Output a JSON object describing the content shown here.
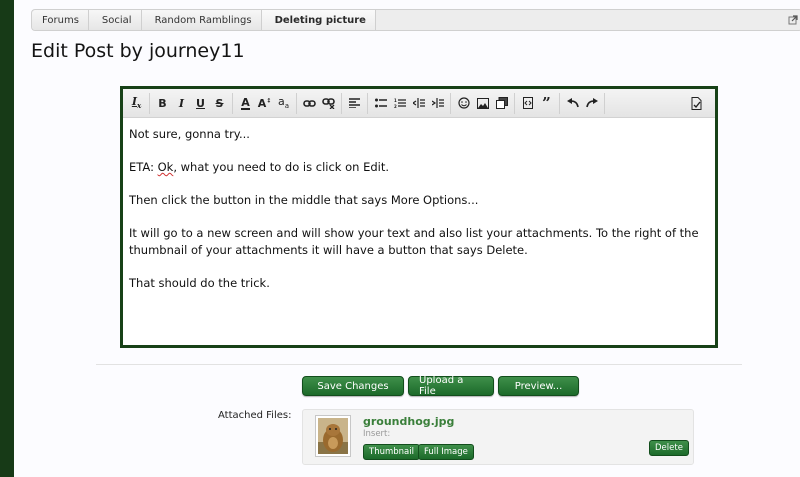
{
  "breadcrumb": {
    "items": [
      "Forums",
      "Social",
      "Random Ramblings",
      "Deleting picture"
    ]
  },
  "page_title": "Edit Post by journey11",
  "editor": {
    "paragraphs": [
      "Not sure, gonna try...",
      "Then click the button in the middle that says More Options...",
      "It will go to a new screen and will show your text and also list your attachments.  To the right of the thumbnail of your attachments it will have a button that says Delete.",
      "That should do the trick."
    ],
    "eta_prefix": "ETA:  ",
    "eta_ok": "Ok",
    "eta_rest": ", what you need to do is click on Edit."
  },
  "toolbar_icons": [
    "remove-format-icon",
    "bold-icon",
    "italic-icon",
    "underline-icon",
    "strikethrough-icon",
    "text-color-icon",
    "font-size-icon",
    "font-family-icon",
    "link-icon",
    "unlink-icon",
    "align-icon",
    "bullet-list-icon",
    "numbered-list-icon",
    "outdent-icon",
    "indent-icon",
    "smiley-icon",
    "image-icon",
    "media-icon",
    "code-icon",
    "quote-icon",
    "undo-icon",
    "redo-icon",
    "toggle-bbcode-icon"
  ],
  "buttons": {
    "save": "Save Changes",
    "upload": "Upload a File",
    "preview": "Preview..."
  },
  "attachments": {
    "label": "Attached Files:",
    "file_name": "groundhog.jpg",
    "insert_label": "Insert:",
    "thumbnail_btn": "Thumbnail",
    "full_image_btn": "Full Image",
    "delete_btn": "Delete"
  },
  "colors": {
    "accent_green": "#1c6a2a",
    "sidebar_dark_green": "#173a17",
    "link_green": "#3a7f3a"
  }
}
